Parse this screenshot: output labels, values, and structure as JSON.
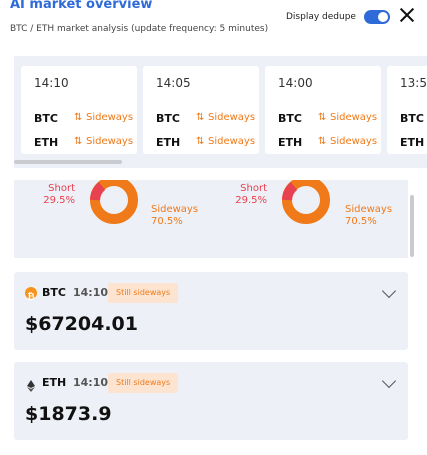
{
  "header": {
    "title": "AI market overview",
    "subtitle": "BTC / ETH market analysis (update frequency: 5 minutes)",
    "dedupe_label": "Display dedupe",
    "dedupe_on": true
  },
  "timeline": [
    {
      "time": "14:10",
      "rows": [
        {
          "coin": "BTC",
          "signal": "Sideways"
        },
        {
          "coin": "ETH",
          "signal": "Sideways"
        }
      ]
    },
    {
      "time": "14:05",
      "rows": [
        {
          "coin": "BTC",
          "signal": "Sideways"
        },
        {
          "coin": "ETH",
          "signal": "Sideways"
        }
      ]
    },
    {
      "time": "14:00",
      "rows": [
        {
          "coin": "BTC",
          "signal": "Sideways"
        },
        {
          "coin": "ETH",
          "signal": "Sideways"
        }
      ]
    },
    {
      "time": "13:5",
      "rows": [
        {
          "coin": "BTC",
          "signal": ""
        },
        {
          "coin": "ETH",
          "signal": ""
        }
      ]
    }
  ],
  "donuts": [
    {
      "short_label": "Short",
      "short_pct": "29.5%",
      "side_label": "Sideways",
      "side_pct": "70.5%"
    },
    {
      "short_label": "Short",
      "short_pct": "29.5%",
      "side_label": "Sideways",
      "side_pct": "70.5%"
    }
  ],
  "colors": {
    "accent": "#2f6bd8",
    "short": "#e8414f",
    "sideways": "#f07a19",
    "btc": "#f7931a"
  },
  "cards": [
    {
      "coin": "BTC",
      "time": "14:10",
      "status": "Still sideways",
      "price": "$67204.01",
      "icon": "bitcoin-icon"
    },
    {
      "coin": "ETH",
      "time": "14:10",
      "status": "Still sideways",
      "price": "$1873.9",
      "icon": "ethereum-icon"
    }
  ]
}
